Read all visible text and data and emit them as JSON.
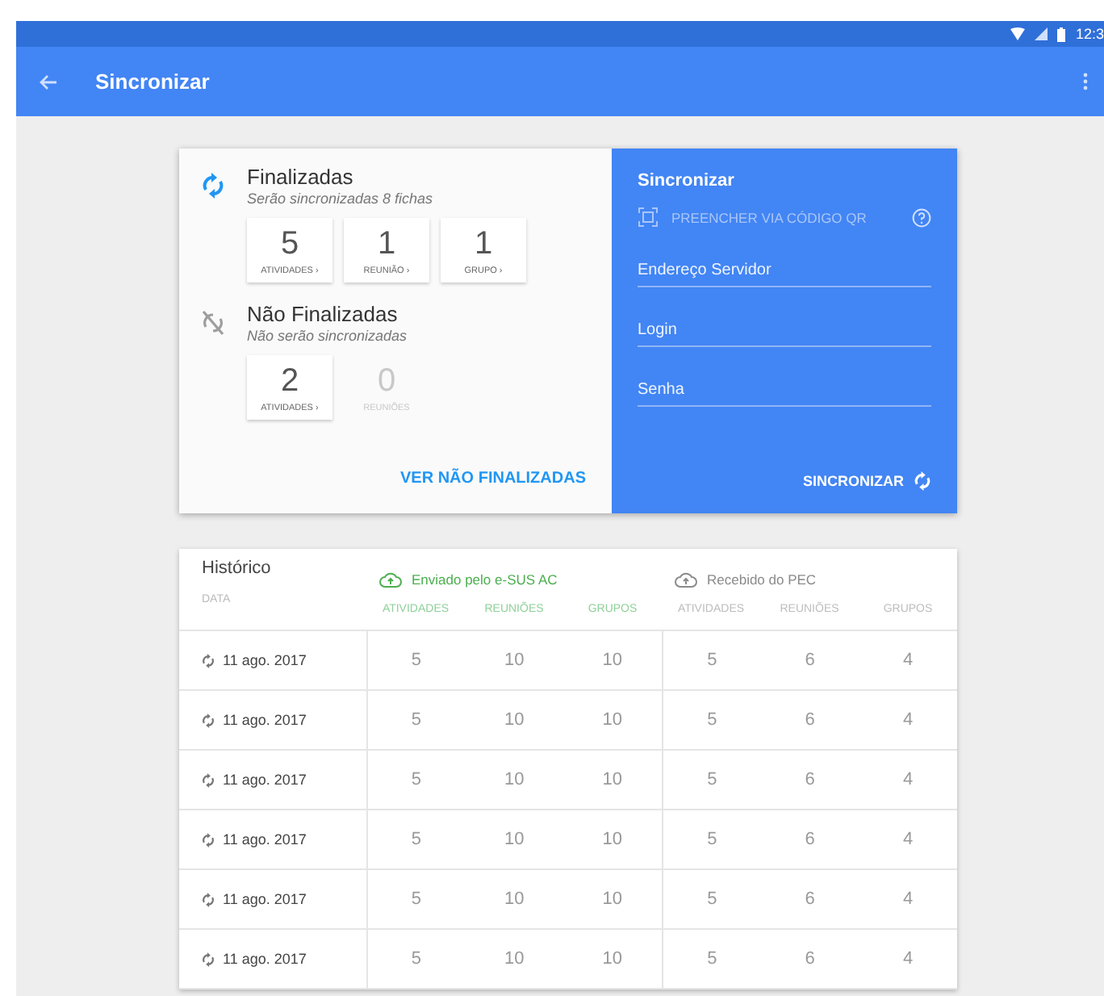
{
  "status_bar": {
    "time": "12:3"
  },
  "app_bar": {
    "title": "Sincronizar"
  },
  "sections": [
    {
      "kind": "synced",
      "title": "Finalizadas",
      "subtitle": "Serão sincronizadas 8 fichas",
      "counts": [
        {
          "value": "5",
          "label": "ATIVIDADES ›",
          "disabled": false
        },
        {
          "value": "1",
          "label": "REUNIÃO ›",
          "disabled": false
        },
        {
          "value": "1",
          "label": "GRUPO ›",
          "disabled": false
        }
      ]
    },
    {
      "kind": "unsynced",
      "title": "Não Finalizadas",
      "subtitle": "Não serão sincronizadas",
      "counts": [
        {
          "value": "2",
          "label": "ATIVIDADES ›",
          "disabled": false
        },
        {
          "value": "0",
          "label": "REUNIÕES",
          "disabled": true
        }
      ]
    }
  ],
  "link": "VER NÃO FINALIZADAS",
  "sync_panel": {
    "title": "Sincronizar",
    "qr_button": "PREENCHER VIA CÓDIGO QR",
    "fields": [
      {
        "placeholder": "Endereço Servidor"
      },
      {
        "placeholder": "Login"
      },
      {
        "placeholder": "Senha"
      }
    ],
    "button": "SINCRONIZAR"
  },
  "history": {
    "title": "Histórico",
    "date_column": "DATA",
    "groups": [
      {
        "kind": "sent",
        "label": "Enviado pelo e-SUS AC",
        "columns": [
          "ATIVIDADES",
          "REUNIÕES",
          "GRUPOS"
        ]
      },
      {
        "kind": "received",
        "label": "Recebido do PEC",
        "columns": [
          "ATIVIDADES",
          "REUNIÕES",
          "GRUPOS"
        ]
      }
    ],
    "rows": [
      {
        "date": "11 ago. 2017",
        "values": [
          "5",
          "10",
          "10",
          "5",
          "6",
          "4"
        ]
      },
      {
        "date": "11 ago. 2017",
        "values": [
          "5",
          "10",
          "10",
          "5",
          "6",
          "4"
        ]
      },
      {
        "date": "11 ago. 2017",
        "values": [
          "5",
          "10",
          "10",
          "5",
          "6",
          "4"
        ]
      },
      {
        "date": "11 ago. 2017",
        "values": [
          "5",
          "10",
          "10",
          "5",
          "6",
          "4"
        ]
      },
      {
        "date": "11 ago. 2017",
        "values": [
          "5",
          "10",
          "10",
          "5",
          "6",
          "4"
        ]
      },
      {
        "date": "11 ago. 2017",
        "values": [
          "5",
          "10",
          "10",
          "5",
          "6",
          "4"
        ]
      }
    ]
  }
}
